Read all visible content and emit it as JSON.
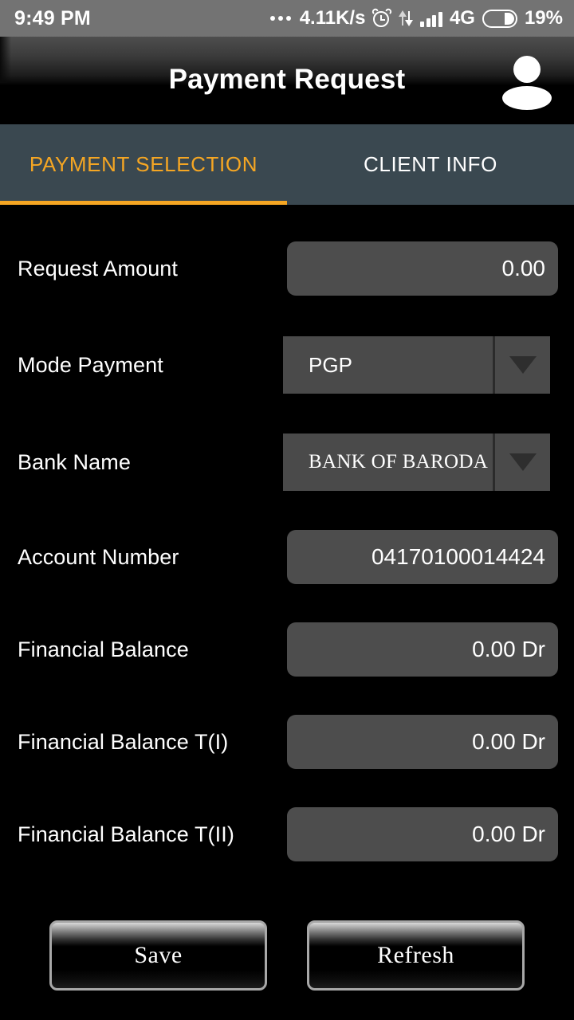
{
  "status_bar": {
    "time": "9:49 PM",
    "network_speed": "4.11K/s",
    "network_type": "4G",
    "battery_percent": "19%",
    "icons": [
      "more-dots-icon",
      "alarm-clock-icon",
      "data-transfer-icon",
      "signal-bars-icon",
      "battery-icon"
    ]
  },
  "header": {
    "title": "Payment Request",
    "avatar_icon": "user-avatar-icon"
  },
  "tabs": [
    {
      "label": "PAYMENT SELECTION",
      "active": true
    },
    {
      "label": "CLIENT INFO",
      "active": false
    }
  ],
  "form": {
    "rows": [
      {
        "label": "Request Amount",
        "value": "0.00",
        "type": "input"
      },
      {
        "label": "Mode Payment",
        "value": "PGP",
        "type": "spinner"
      },
      {
        "label": "Bank Name",
        "value": "BANK OF BARODA",
        "type": "spinner"
      },
      {
        "label": "Account Number",
        "value": "04170100014424",
        "type": "input"
      },
      {
        "label": "Financial Balance",
        "value": "0.00 Dr",
        "type": "input"
      },
      {
        "label": "Financial Balance T(I)",
        "value": "0.00 Dr",
        "type": "input"
      },
      {
        "label": "Financial Balance T(II)",
        "value": "0.00 Dr",
        "type": "input"
      }
    ]
  },
  "buttons": {
    "save": "Save",
    "refresh": "Refresh"
  },
  "colors": {
    "status_bar_bg": "#737373",
    "tab_bar_bg": "#3a4850",
    "accent": "#f5a623",
    "field_bg": "#4d4d4d",
    "spinner_bg": "#4a4a4a",
    "page_bg": "#000000"
  }
}
